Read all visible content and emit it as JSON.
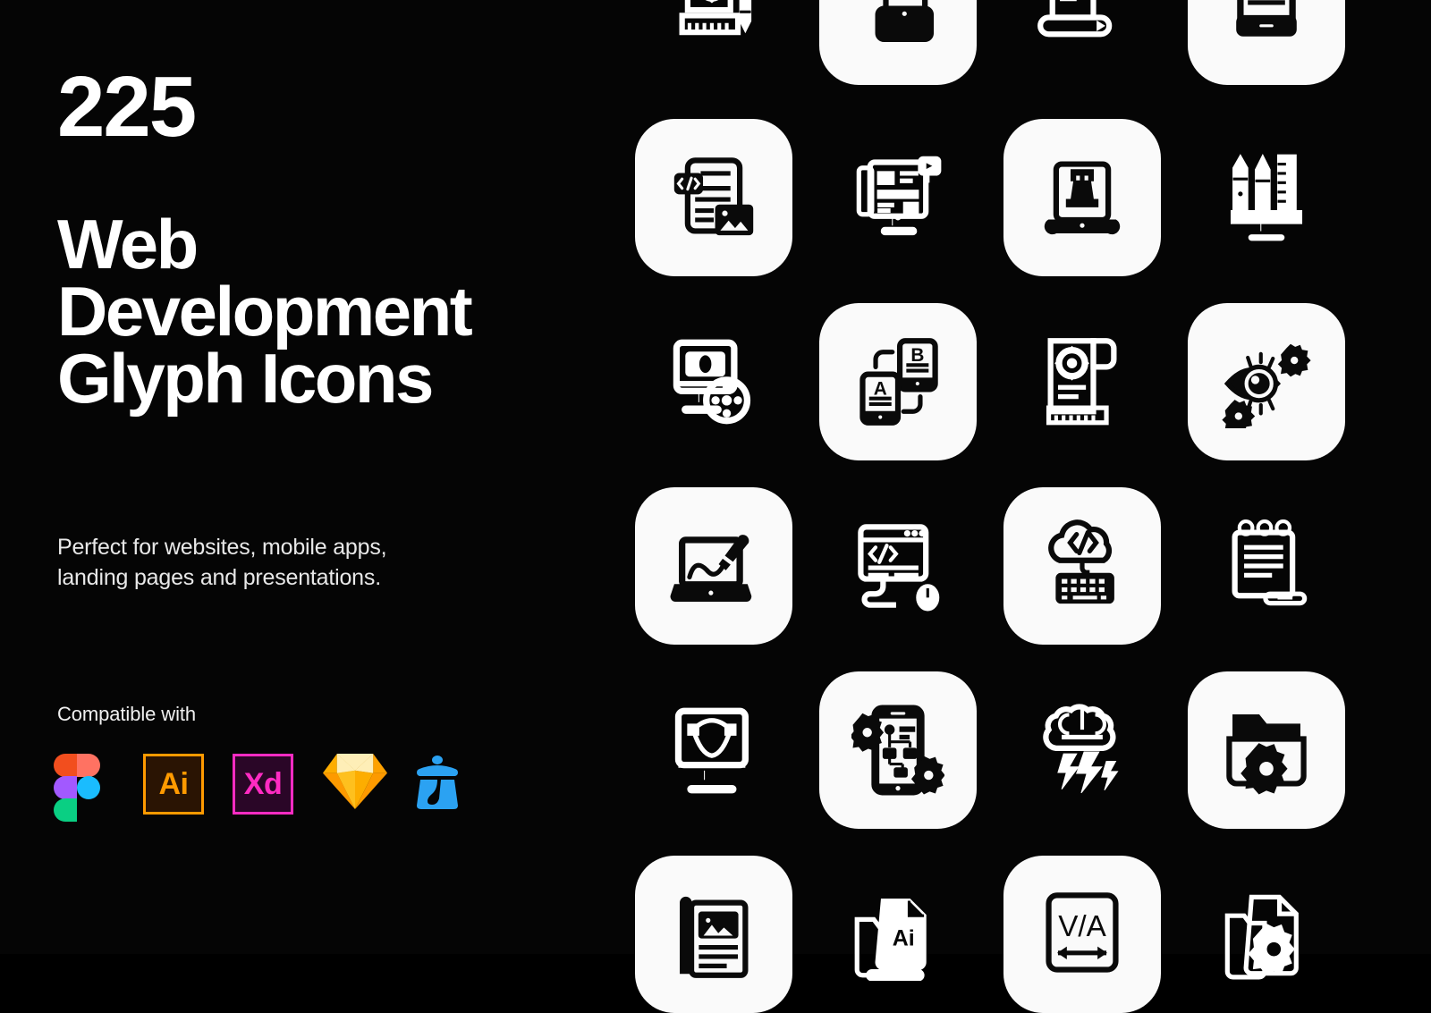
{
  "background_color": "#050505",
  "card_color": "#fafafa",
  "left_panel": {
    "count": "225",
    "headline_lines": [
      "Web",
      "Development",
      "Glyph Icons"
    ],
    "subtitle_lines": [
      "Perfect for websites, mobile apps,",
      "landing pages and presentations."
    ],
    "compatible_label": "Compatible with",
    "logos": [
      {
        "name": "figma-logo",
        "label": "Figma",
        "colors": [
          "#F24E1E",
          "#FF7262",
          "#A259FF",
          "#1ABCFE",
          "#0ACF83"
        ]
      },
      {
        "name": "adobe-illustrator-logo",
        "label": "Ai",
        "color": "#FF9A00"
      },
      {
        "name": "adobe-xd-logo",
        "label": "Xd",
        "color": "#FF2BC2"
      },
      {
        "name": "sketch-logo",
        "label": "Sketch",
        "color": "#FDB300"
      },
      {
        "name": "vector-app-logo",
        "label": "Vectornator",
        "color": "#2BA2F2"
      }
    ]
  },
  "grid": {
    "columns": 4,
    "rows": 6,
    "cells": [
      {
        "row": 1,
        "col": 1,
        "carded": false,
        "icon": "blueprint-ruler-pencil-icon",
        "label": "Blueprint with ruler and pencil"
      },
      {
        "row": 1,
        "col": 2,
        "carded": true,
        "icon": "mobile-settings-gears-icon",
        "label": "Mobile app settings gears"
      },
      {
        "row": 1,
        "col": 3,
        "carded": false,
        "icon": "scroll-document-video-icon",
        "label": "Scroll document with video"
      },
      {
        "row": 1,
        "col": 4,
        "carded": true,
        "icon": "tablet-layout-icon",
        "label": "Tablet web layout"
      },
      {
        "row": 2,
        "col": 1,
        "carded": true,
        "icon": "code-article-image-icon",
        "label": "Code article with image"
      },
      {
        "row": 2,
        "col": 2,
        "carded": false,
        "icon": "desktop-wireframe-video-icon",
        "label": "Desktop wireframe with video marker"
      },
      {
        "row": 2,
        "col": 3,
        "carded": true,
        "icon": "laptop-chess-rook-icon",
        "label": "Laptop strategy rook"
      },
      {
        "row": 2,
        "col": 4,
        "carded": false,
        "icon": "design-tools-monitor-icon",
        "label": "Monitor with pen, pencil and ruler"
      },
      {
        "row": 3,
        "col": 1,
        "carded": false,
        "icon": "desktop-video-reel-icon",
        "label": "Desktop video with film reel"
      },
      {
        "row": 3,
        "col": 2,
        "carded": true,
        "icon": "ab-testing-icon",
        "label": "A/B testing on mobile"
      },
      {
        "row": 3,
        "col": 3,
        "carded": false,
        "icon": "scroll-settings-ruler-icon",
        "label": "Scroll settings with ruler"
      },
      {
        "row": 3,
        "col": 4,
        "carded": true,
        "icon": "eye-vision-settings-icon",
        "label": "Eye vision with gears"
      },
      {
        "row": 4,
        "col": 1,
        "carded": true,
        "icon": "laptop-paint-brush-icon",
        "label": "Laptop with paint brush"
      },
      {
        "row": 4,
        "col": 2,
        "carded": false,
        "icon": "browser-code-mouse-icon",
        "label": "Browser code window with mouse"
      },
      {
        "row": 4,
        "col": 3,
        "carded": true,
        "icon": "cloud-code-keyboard-icon",
        "label": "Cloud coding with keyboard"
      },
      {
        "row": 4,
        "col": 4,
        "carded": false,
        "icon": "notepad-pen-icon",
        "label": "Spiral notepad with pen"
      },
      {
        "row": 5,
        "col": 1,
        "carded": false,
        "icon": "monitor-bezier-curve-icon",
        "label": "Monitor with bezier curve"
      },
      {
        "row": 5,
        "col": 2,
        "carded": true,
        "icon": "mobile-flowchart-gears-icon",
        "label": "Mobile flowchart with gears"
      },
      {
        "row": 5,
        "col": 3,
        "carded": false,
        "icon": "brainstorm-lightning-icon",
        "label": "Brain with lightning bolts"
      },
      {
        "row": 5,
        "col": 4,
        "carded": true,
        "icon": "folder-settings-icon",
        "label": "Folder with gear"
      },
      {
        "row": 6,
        "col": 1,
        "carded": true,
        "icon": "article-image-pen-icon",
        "label": "Article page with image and pen"
      },
      {
        "row": 6,
        "col": 2,
        "carded": false,
        "icon": "ai-file-icon",
        "label": "Ai vector file"
      },
      {
        "row": 6,
        "col": 3,
        "carded": true,
        "icon": "kerning-va-icon",
        "label": "V/A kerning spacing"
      },
      {
        "row": 6,
        "col": 4,
        "carded": false,
        "icon": "file-settings-sync-icon",
        "label": "File with settings sync"
      }
    ]
  }
}
